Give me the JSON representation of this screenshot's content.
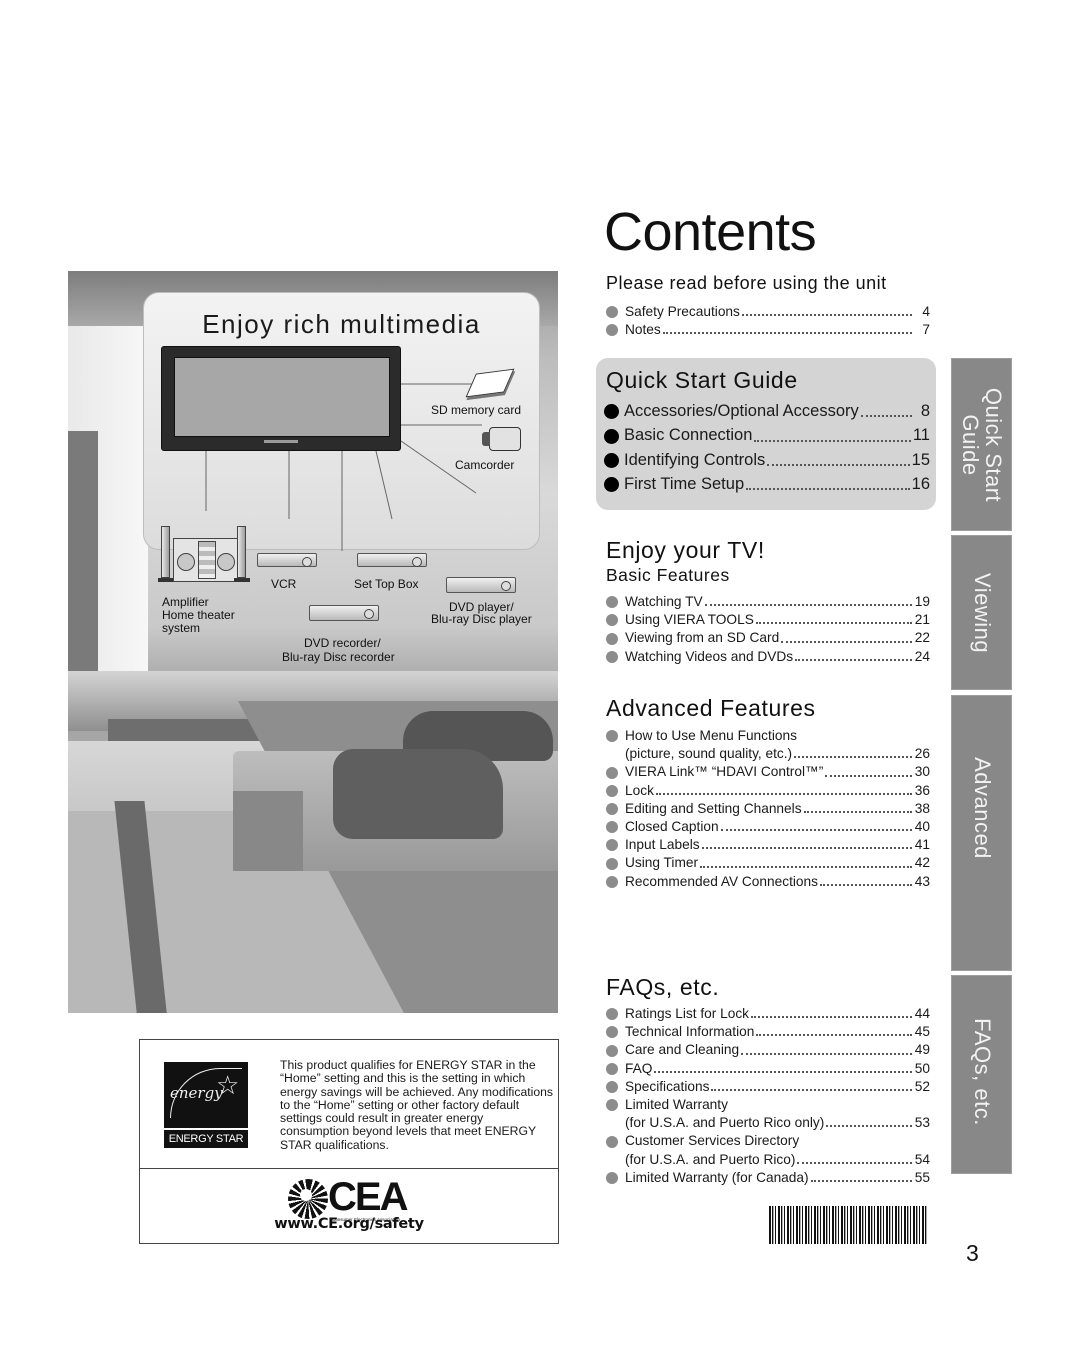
{
  "page": {
    "title": "Contents",
    "page_number": "3"
  },
  "multimedia": {
    "title": "Enjoy rich multimedia",
    "devices": {
      "sd_card": "SD memory card",
      "camcorder": "Camcorder",
      "vcr": "VCR",
      "set_top_box": "Set Top Box",
      "amplifier_line1": "Amplifier",
      "amplifier_line2": "Home theater",
      "amplifier_line3": "system",
      "dvd_player_line1": "DVD player/",
      "dvd_player_line2": "Blu-ray Disc player",
      "dvd_recorder_line1": "DVD recorder/",
      "dvd_recorder_line2": "Blu-ray Disc recorder"
    }
  },
  "energy_star": {
    "logo_label": "ENERGY STAR",
    "logo_script": "energy",
    "text": "This product qualifies for ENERGY STAR in the “Home” setting and this is the setting in which energy savings will be achieved. Any modifications to the “Home” setting or other factory default settings could result in greater energy consumption beyond levels that meet ENERGY STAR qualifications."
  },
  "cea": {
    "logo_text": "CEA",
    "association": "Consumer Electronics Association",
    "url": "www.CE.org/safety"
  },
  "toc": {
    "please_read": {
      "heading": "Please read before using the unit",
      "items": [
        {
          "label": "Safety Precautions",
          "page": "4"
        },
        {
          "label": "Notes",
          "page": "7"
        }
      ]
    },
    "quick_start": {
      "heading": "Quick Start Guide",
      "items": [
        {
          "label": "Accessories/Optional Accessory",
          "page": "8"
        },
        {
          "label": "Basic Connection",
          "page": "11"
        },
        {
          "label": "Identifying Controls",
          "page": "15"
        },
        {
          "label": "First Time Setup",
          "page": "16"
        }
      ]
    },
    "enjoy_tv": {
      "heading": "Enjoy your TV!",
      "subheading": "Basic Features",
      "items": [
        {
          "label": "Watching TV",
          "page": "19"
        },
        {
          "label": "Using VIERA TOOLS",
          "page": "21"
        },
        {
          "label": "Viewing from an SD Card",
          "page": "22"
        },
        {
          "label": "Watching Videos and DVDs",
          "page": "24"
        }
      ]
    },
    "advanced": {
      "heading": "Advanced Features",
      "items": [
        {
          "label": "How to Use Menu Functions",
          "page": ""
        },
        {
          "label": "(picture, sound quality, etc.)",
          "page": "26"
        },
        {
          "label": "VIERA Link™ “HDAVI Control™”",
          "page": "30"
        },
        {
          "label": "Lock",
          "page": "36"
        },
        {
          "label": "Editing and Setting Channels",
          "page": "38"
        },
        {
          "label": "Closed Caption",
          "page": "40"
        },
        {
          "label": "Input Labels",
          "page": "41"
        },
        {
          "label": "Using Timer",
          "page": "42"
        },
        {
          "label": "Recommended AV Connections",
          "page": "43"
        }
      ]
    },
    "faqs": {
      "heading": "FAQs, etc.",
      "items": [
        {
          "label": "Ratings List for Lock",
          "page": "44"
        },
        {
          "label": "Technical Information",
          "page": "45"
        },
        {
          "label": "Care and Cleaning",
          "page": "49"
        },
        {
          "label": "FAQ",
          "page": "50"
        },
        {
          "label": "Specifications",
          "page": "52"
        },
        {
          "label": "Limited Warranty",
          "page": ""
        },
        {
          "label": "(for U.S.A. and Puerto Rico only)",
          "page": "53"
        },
        {
          "label": "Customer Services Directory",
          "page": ""
        },
        {
          "label": "(for U.S.A. and Puerto Rico)",
          "page": "54"
        },
        {
          "label": "Limited Warranty (for Canada)",
          "page": "55"
        }
      ]
    }
  },
  "side_tabs": [
    {
      "label": "Quick Start Guide",
      "line1": "Quick Start",
      "line2": "Guide"
    },
    {
      "label": "Viewing"
    },
    {
      "label": "Advanced"
    },
    {
      "label": "FAQs, etc."
    }
  ],
  "colors": {
    "tab_bg": "#888888",
    "quick_start_box_bg": "#d4d4d4",
    "bullet_grey": "#8c8c8c",
    "bullet_black": "#000000"
  }
}
